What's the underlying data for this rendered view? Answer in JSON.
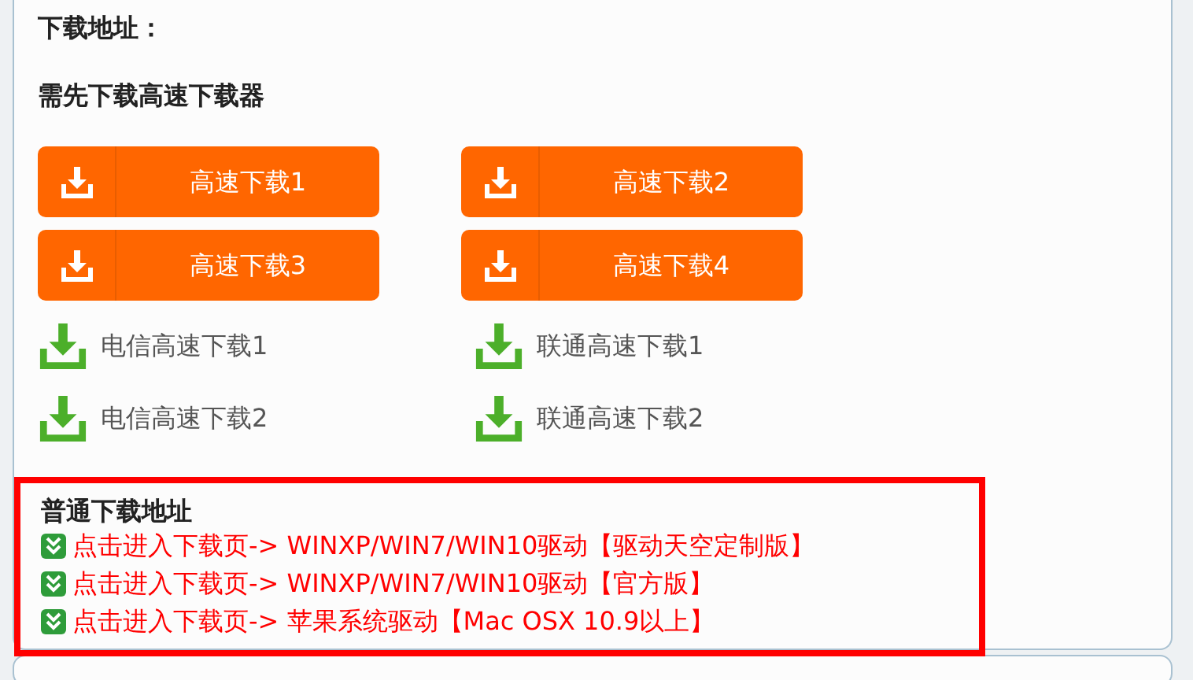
{
  "heading": "下载地址：",
  "subheading": "需先下载高速下载器",
  "fast_buttons": [
    {
      "label": "高速下载1"
    },
    {
      "label": "高速下载2"
    },
    {
      "label": "高速下载3"
    },
    {
      "label": "高速下载4"
    }
  ],
  "mirror_links": [
    {
      "label": "电信高速下载1"
    },
    {
      "label": "联通高速下载1"
    },
    {
      "label": "电信高速下载2"
    },
    {
      "label": "联通高速下载2"
    }
  ],
  "normal_section": {
    "title": "普通下载地址",
    "links": [
      {
        "label": "点击进入下载页-> WINXP/WIN7/WIN10驱动【驱动天空定制版】"
      },
      {
        "label": "点击进入下载页-> WINXP/WIN7/WIN10驱动【官方版】"
      },
      {
        "label": "点击进入下载页-> 苹果系统驱动【Mac OSX 10.9以上】"
      }
    ]
  }
}
